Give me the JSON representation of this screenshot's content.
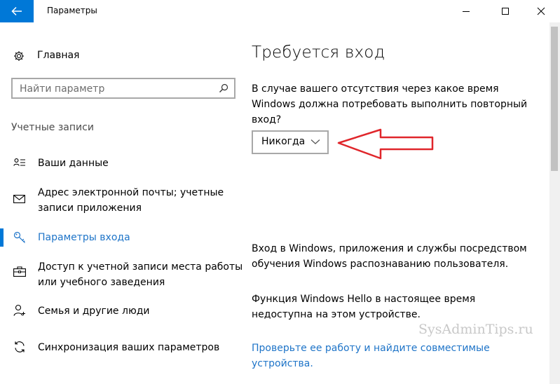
{
  "window": {
    "title": "Параметры",
    "accent": "#0078d7"
  },
  "sidebar": {
    "home_label": "Главная",
    "search_placeholder": "Найти параметр",
    "section_label": "Учетные записи",
    "items": [
      {
        "label_lines": [
          "Ваши данные"
        ],
        "icon": "person-card-icon"
      },
      {
        "label_lines": [
          "Адрес электронной почты; учетные",
          "записи приложения"
        ],
        "icon": "mail-icon"
      },
      {
        "label_lines": [
          "Параметры входа"
        ],
        "icon": "key-icon",
        "active": true
      },
      {
        "label_lines": [
          "Доступ к учетной записи места работы",
          "или учебного заведения"
        ],
        "icon": "briefcase-icon"
      },
      {
        "label_lines": [
          "Семья и другие люди"
        ],
        "icon": "add-person-icon"
      },
      {
        "label_lines": [
          "Синхронизация ваших параметров"
        ],
        "icon": "sync-icon"
      }
    ]
  },
  "content": {
    "heading": "Требуется вход",
    "description_lines": [
      "В случае вашего отсутствия через какое время",
      "Windows должна потребовать выполнить повторный",
      "вход?"
    ],
    "dropdown_value": "Никогда",
    "info1_lines": [
      "Вход в Windows, приложения и службы посредством",
      "обучения Windows распознаванию пользователя."
    ],
    "info2_lines": [
      "Функция Windows Hello в настоящее время",
      "недоступна на этом устройстве."
    ],
    "link_lines": [
      "Проверьте ее работу и найдите совместимые",
      "устройства."
    ]
  },
  "watermark": "SysAdminTips.ru",
  "colors": {
    "link": "#1e74c8",
    "annotation_arrow": "#e0262b"
  }
}
